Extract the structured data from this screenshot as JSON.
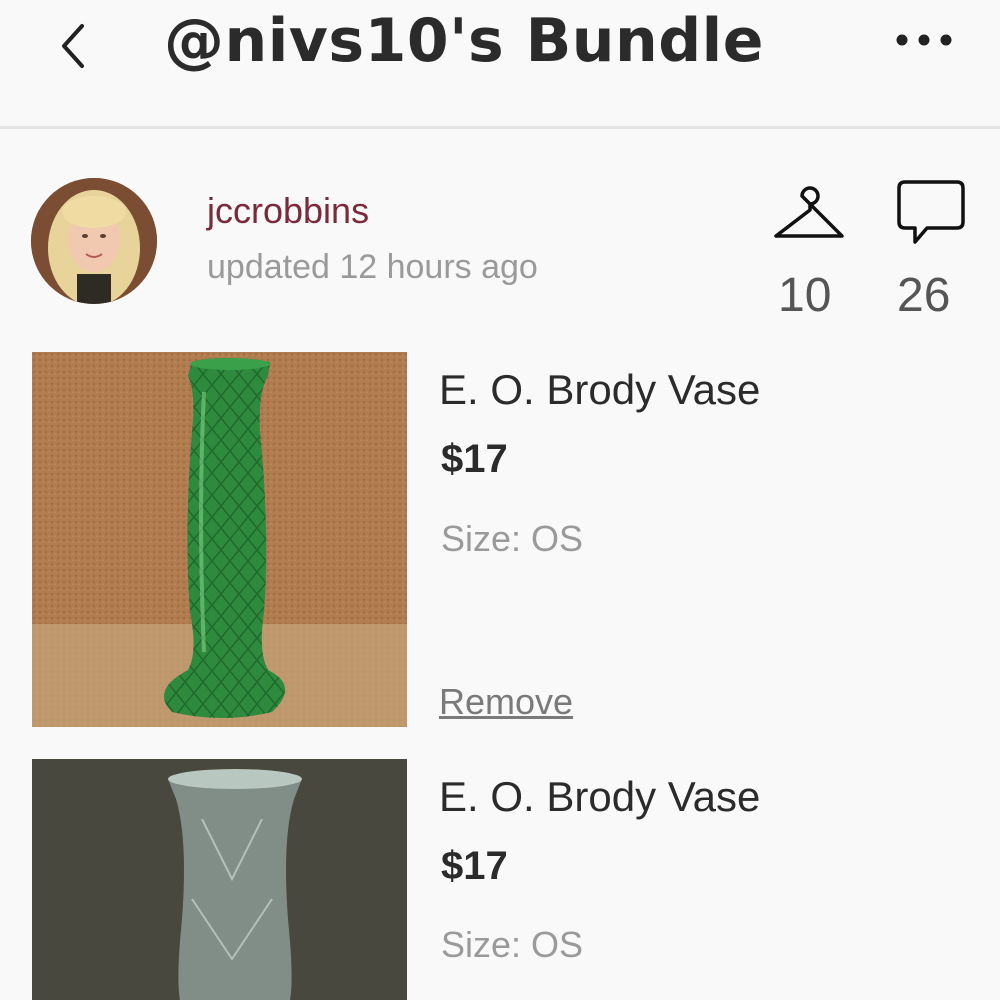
{
  "header": {
    "title": "@nivs10's Bundle",
    "back_icon": "chevron-left-icon",
    "more_icon": "more-horizontal-icon"
  },
  "seller": {
    "username": "jccrobbins",
    "updated": "updated 12 hours ago"
  },
  "stats": {
    "likes_icon": "hanger-icon",
    "likes_count": "10",
    "comments_icon": "comment-bubble-icon",
    "comments_count": "26"
  },
  "items": [
    {
      "title": "E. O. Brody Vase",
      "price": "$17",
      "size": "Size:  OS",
      "remove_label": "Remove",
      "image_desc_color": "#2e8a3c"
    },
    {
      "title": "E. O. Brody Vase",
      "price": "$17",
      "size": "Size:  OS",
      "image_desc_color": "#9fb0a8"
    }
  ],
  "colors": {
    "username": "#7a2b3b",
    "muted_text": "#9a9a9a",
    "background": "#f9f9f9"
  }
}
